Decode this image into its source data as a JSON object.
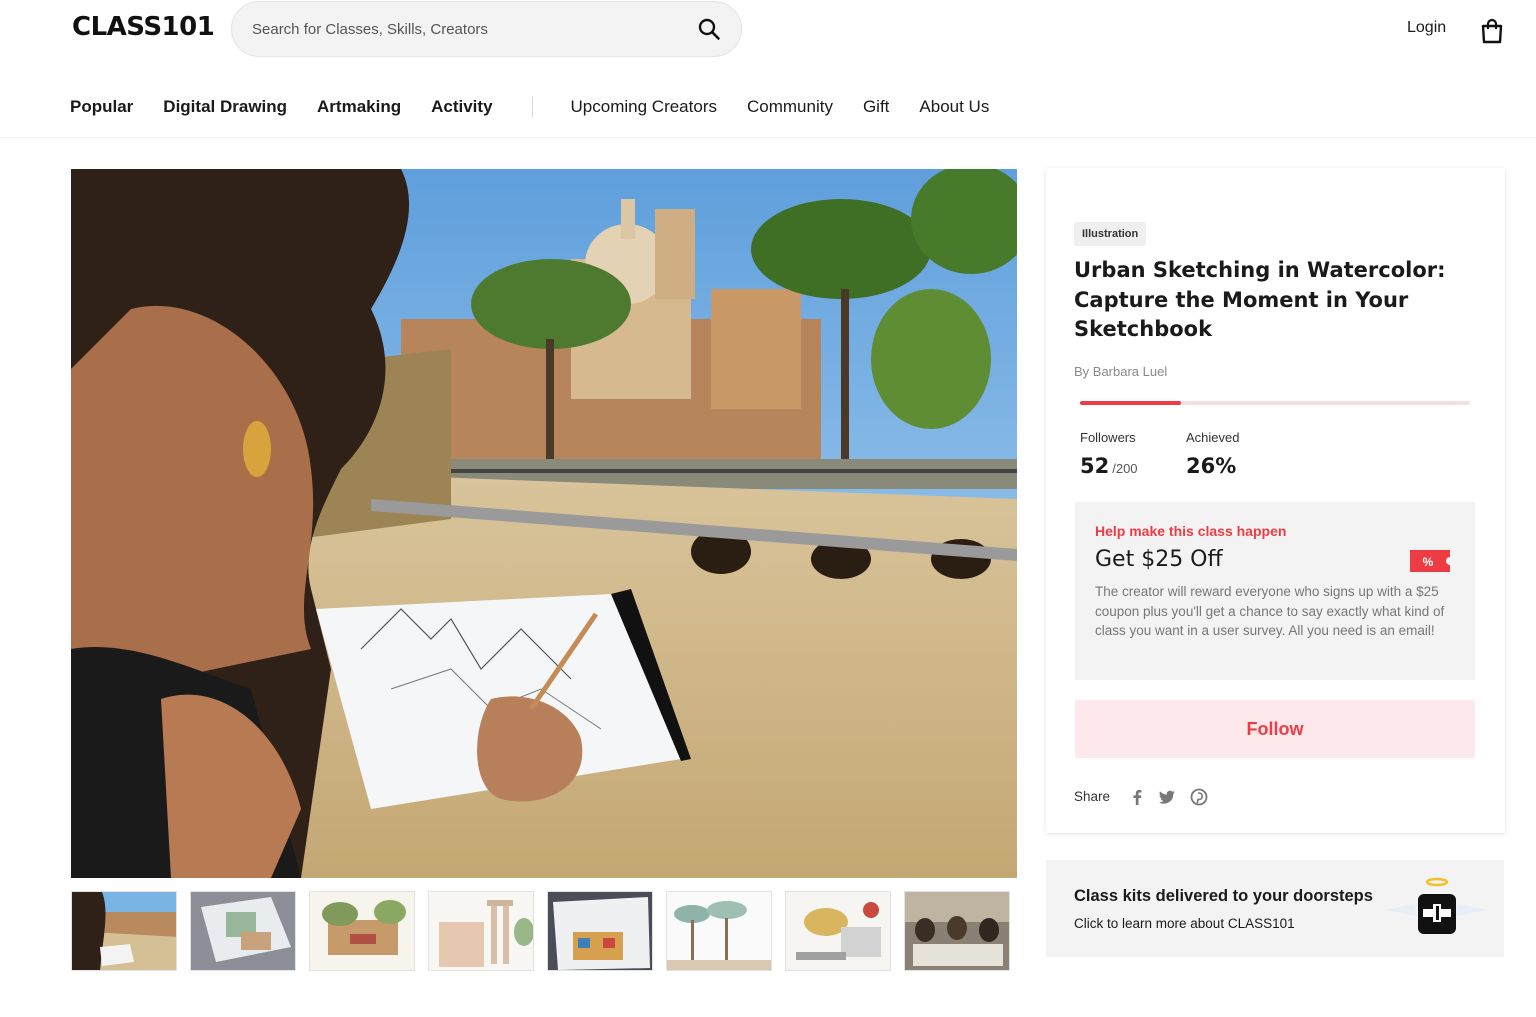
{
  "header": {
    "logo": "CLASS101",
    "search_placeholder": "Search for Classes, Skills, Creators",
    "login_label": "Login",
    "cart_icon": "shopping-bag-icon",
    "search_icon": "search-icon"
  },
  "nav": {
    "primary": [
      "Popular",
      "Digital Drawing",
      "Artmaking",
      "Activity"
    ],
    "secondary": [
      "Upcoming Creators",
      "Community",
      "Gift",
      "About Us"
    ]
  },
  "gallery": {
    "thumbnail_count": 8,
    "selected_index": 0
  },
  "class": {
    "category": "Illustration",
    "title": "Urban Sketching in Watercolor: Capture the Moment in Your Sketchbook",
    "author": "By Barbara Luel",
    "progress_fraction": 0.26,
    "followers_label": "Followers",
    "followers_value": "52",
    "followers_goal": "/200",
    "achieved_label": "Achieved",
    "achieved_value": "26%"
  },
  "promo": {
    "kicker": "Help make this class happen",
    "title": "Get $25 Off",
    "badge": "%",
    "body": "The creator will reward everyone who signs up with a $25 coupon plus you'll get a chance to say exactly what kind of class you want in a user survey. All you need is an email!"
  },
  "follow_label": "Follow",
  "share": {
    "label": "Share",
    "icons": [
      "facebook-icon",
      "twitter-icon",
      "pinterest-icon"
    ]
  },
  "kits": {
    "title": "Class kits delivered to your doorsteps",
    "subtitle": "Click to learn more about CLASS101"
  },
  "colors": {
    "accent": "#ee3c45",
    "follow_bg": "#fde8eb",
    "panel_bg": "#f3f3f3"
  }
}
